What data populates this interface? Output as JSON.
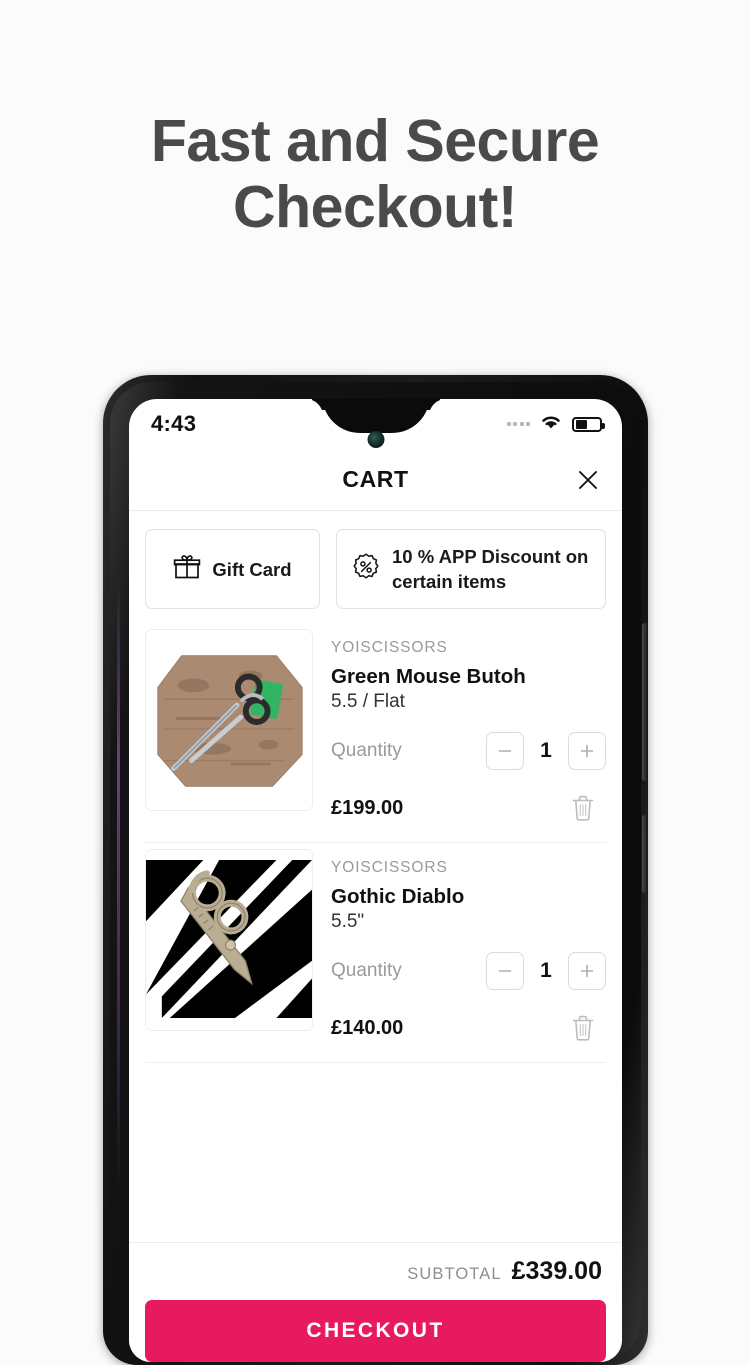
{
  "promo": {
    "headline_line1": "Fast and Secure",
    "headline_line2": "Checkout!"
  },
  "status_bar": {
    "time": "4:43",
    "signal_icon": "signal-dots-icon",
    "wifi_icon": "wifi-icon",
    "battery_icon": "battery-icon",
    "battery_level_percent": 40
  },
  "header": {
    "title": "CART",
    "close_icon": "close-icon"
  },
  "promos": [
    {
      "icon": "gift-icon",
      "label": "Gift Card"
    },
    {
      "icon": "percent-badge-icon",
      "label": "10 % APP Discount on certain items"
    }
  ],
  "cart": {
    "items": [
      {
        "vendor": "YOISCISSORS",
        "title": "Green Mouse Butoh",
        "variant": "5.5 / Flat",
        "quantity_label": "Quantity",
        "quantity": "1",
        "price": "£199.00",
        "decrement_icon": "minus-icon",
        "increment_icon": "plus-icon",
        "remove_icon": "trash-icon",
        "image_alt": "scissors-on-wood-thumbnail"
      },
      {
        "vendor": "YOISCISSORS",
        "title": "Gothic Diablo",
        "variant": "5.5\"",
        "quantity_label": "Quantity",
        "quantity": "1",
        "price": "£140.00",
        "decrement_icon": "minus-icon",
        "increment_icon": "plus-icon",
        "remove_icon": "trash-icon",
        "image_alt": "gothic-scissors-thumbnail"
      }
    ]
  },
  "footer": {
    "subtotal_label": "SUBTOTAL",
    "subtotal_value": "£339.00",
    "checkout_label": "CHECKOUT"
  },
  "colors": {
    "background": "#fbfbfb",
    "headline": "#4a4a4a",
    "accent": "#e81a5f",
    "muted_text": "#9a9a9a"
  }
}
